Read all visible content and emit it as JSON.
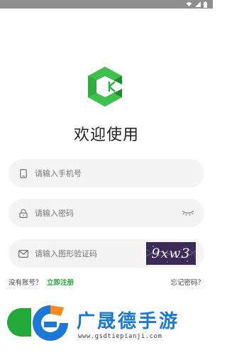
{
  "status_bar": {
    "icons": [
      "wifi-icon",
      "signal-icon",
      "battery-icon"
    ]
  },
  "logo": {
    "name": "app-logo",
    "colors": {
      "light": "#3ec24c",
      "dark": "#1e8a2e"
    }
  },
  "page": {
    "title": "欢迎使用"
  },
  "form": {
    "phone": {
      "placeholder": "请输入手机号",
      "value": ""
    },
    "password": {
      "placeholder": "请输入密码",
      "value": ""
    },
    "captcha": {
      "placeholder": "请输入图形验证码",
      "value": "",
      "image_text": "9xw3"
    }
  },
  "links": {
    "no_account": "没有账号？",
    "register": "立即注册",
    "forgot_password": "忘记密码？"
  },
  "watermark": {
    "brand_text": "广晟德手游",
    "url": "www.gsdtiepianji.com"
  },
  "colors": {
    "accent": "#27a83f",
    "field_bg": "#f4f4f4",
    "watermark_blue": "#1a78d6"
  }
}
